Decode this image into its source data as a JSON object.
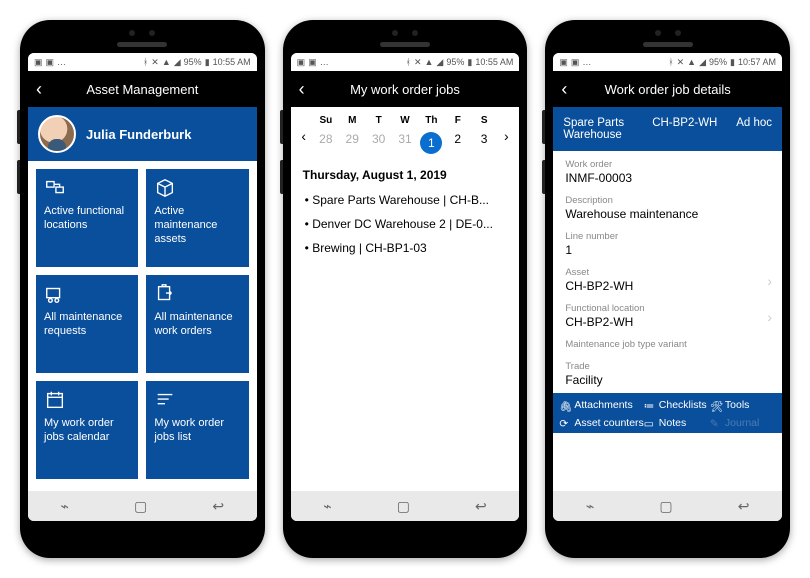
{
  "status": {
    "battery": "95%",
    "time1": "10:55 AM",
    "time2": "10:55 AM",
    "time3": "10:57 AM"
  },
  "s1": {
    "title": "Asset Management",
    "user": "Julia Funderburk",
    "tiles": [
      "Active functional locations",
      "Active maintenance assets",
      "All maintenance requests",
      "All maintenance work orders",
      "My work order jobs calendar",
      "My work order jobs list"
    ]
  },
  "s2": {
    "title": "My work order jobs",
    "dows": [
      "Su",
      "M",
      "T",
      "W",
      "Th",
      "F",
      "S"
    ],
    "days": [
      {
        "n": "28",
        "grey": true
      },
      {
        "n": "29",
        "grey": true
      },
      {
        "n": "30",
        "grey": true
      },
      {
        "n": "31",
        "grey": true
      },
      {
        "n": "1",
        "selected": true
      },
      {
        "n": "2"
      },
      {
        "n": "3"
      }
    ],
    "date_heading": "Thursday, August 1, 2019",
    "events": [
      "Spare Parts Warehouse | CH-B...",
      "Denver DC Warehouse 2 | DE-0...",
      "Brewing | CH-BP1-03"
    ]
  },
  "s3": {
    "title": "Work order job details",
    "strip": [
      "Spare Parts Warehouse",
      "CH-BP2-WH",
      "Ad hoc"
    ],
    "fields": [
      {
        "lbl": "Work order",
        "val": "INMF-00003"
      },
      {
        "lbl": "Description",
        "val": "Warehouse maintenance"
      },
      {
        "lbl": "Line number",
        "val": "1"
      },
      {
        "lbl": "Asset",
        "val": "CH-BP2-WH",
        "chev": true
      },
      {
        "lbl": "Functional location",
        "val": "CH-BP2-WH",
        "chev": true
      },
      {
        "lbl": "Maintenance job type variant",
        "val": ""
      },
      {
        "lbl": "Trade",
        "val": "Facility"
      }
    ],
    "tabs": [
      "Attachments",
      "Checklists",
      "Tools",
      "Asset counters",
      "Notes",
      "Journal"
    ]
  }
}
